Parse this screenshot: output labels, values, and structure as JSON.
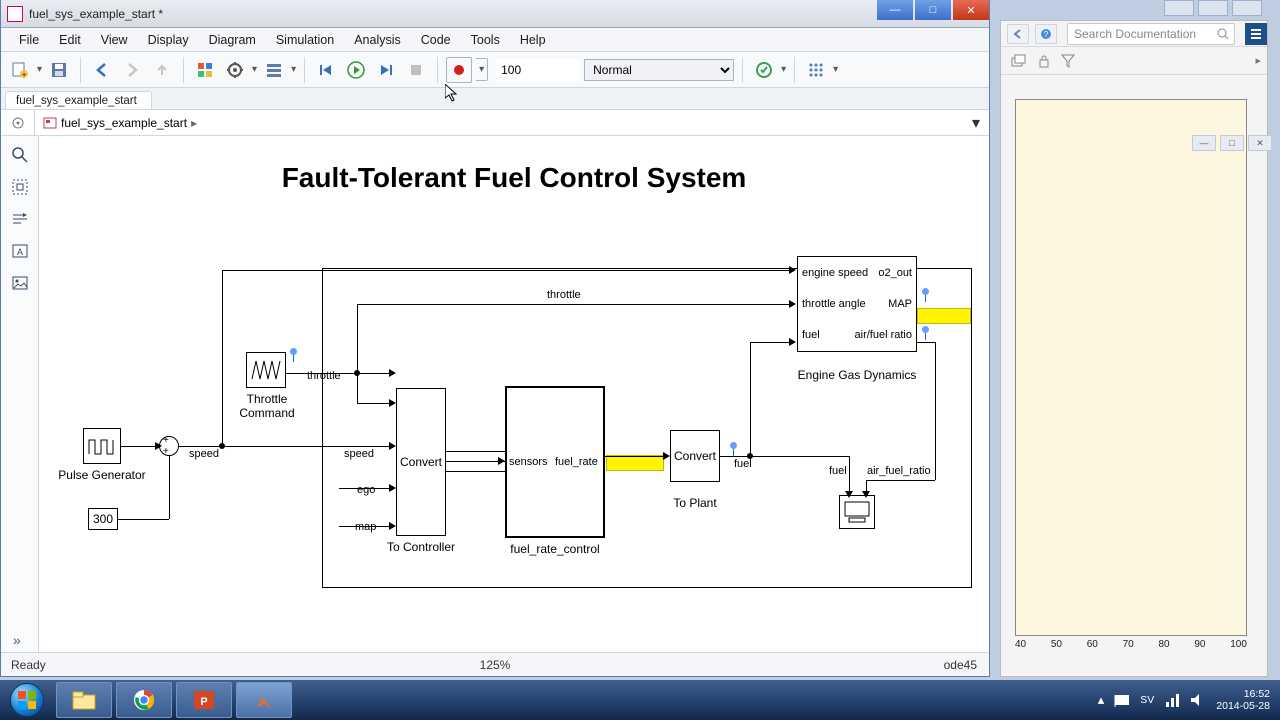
{
  "window": {
    "title": "fuel_sys_example_start *"
  },
  "menu": {
    "items": [
      "File",
      "Edit",
      "View",
      "Display",
      "Diagram",
      "Simulation",
      "Analysis",
      "Code",
      "Tools",
      "Help"
    ]
  },
  "toolbar": {
    "sim_time": "100",
    "mode": "Normal"
  },
  "tab": {
    "label": "fuel_sys_example_start"
  },
  "breadcrumb": {
    "root": "fuel_sys_example_start"
  },
  "diagram": {
    "title": "Fault-Tolerant Fuel Control System",
    "blocks": {
      "pulse_gen": "Pulse Generator",
      "throttle_cmd": "Throttle\nCommand",
      "const300": "300",
      "to_controller": "To Controller",
      "convert1": "Convert",
      "fuel_rate_control": "fuel_rate_control",
      "convert2": "Convert",
      "to_plant": "To Plant",
      "engine_gas": "Engine Gas Dynamics"
    },
    "signals": {
      "throttle_top": "throttle",
      "throttle": "throttle",
      "speed_l": "speed",
      "speed_r": "speed",
      "ego": "ego",
      "map": "map",
      "sensors": "sensors",
      "fuel_rate": "fuel_rate",
      "fuel": "fuel",
      "fuel2": "fuel",
      "air_fuel_ratio": "air_fuel_ratio",
      "eng_speed": "engine speed",
      "o2_out": "o2_out",
      "throttle_angle": "throttle angle",
      "MAP": "MAP",
      "eng_fuel": "fuel",
      "afr": "air/fuel ratio"
    }
  },
  "status": {
    "ready": "Ready",
    "zoom": "125%",
    "solver": "ode45"
  },
  "help_search": {
    "placeholder": "Search Documentation"
  },
  "bgplot": {
    "ticks": [
      "40",
      "50",
      "60",
      "70",
      "80",
      "90",
      "100"
    ]
  },
  "tray": {
    "lang": "SV",
    "time": "16:52",
    "date": "2014-05-28"
  }
}
